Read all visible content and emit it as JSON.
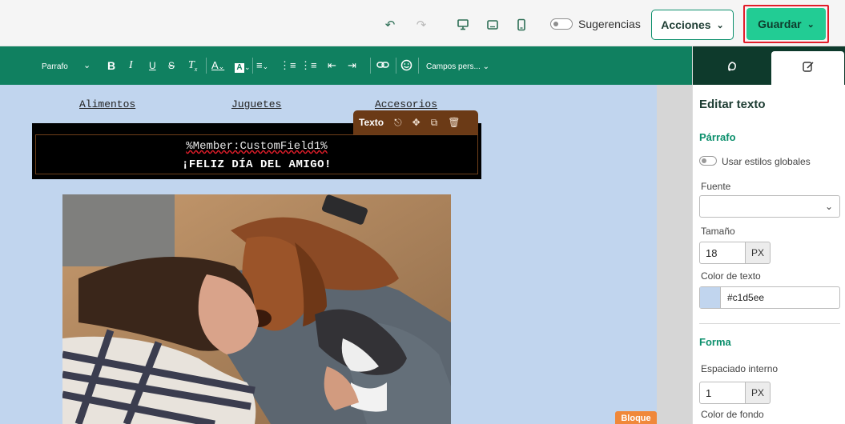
{
  "topbar": {
    "undo_icon": "undo-icon",
    "redo_icon": "redo-icon",
    "desktop_icon": "desktop-icon",
    "tablet_icon": "tablet-icon",
    "mobile_icon": "mobile-icon",
    "suggestions_label": "Sugerencias",
    "suggestions_on": false,
    "actions_label": "Acciones",
    "save_label": "Guardar",
    "accent_color": "#22cc94",
    "highlight_color": "#e21d2a"
  },
  "format_toolbar": {
    "paragraph_style": "Parrafo",
    "custom_fields_label": "Campos pers...",
    "tools": [
      "bold-icon",
      "italic-icon",
      "underline-icon",
      "strikethrough-icon",
      "clear-format-icon",
      "font-color-icon",
      "highlight-icon",
      "align-icon",
      "bullet-list-icon",
      "numbered-list-icon",
      "outdent-icon",
      "indent-icon",
      "link-icon",
      "emoji-icon"
    ],
    "background_color": "#108060"
  },
  "canvas": {
    "background_color": "#c1d5ee",
    "nav_links": [
      "Alimentos",
      "Juguetes",
      "Accesorios"
    ],
    "merge_field": "%Member:CustomField1%",
    "headline": "¡FELIZ DÍA DEL AMIGO!",
    "text_toolbar_label": "Texto",
    "text_toolbar_icons": [
      "save-block-icon",
      "move-icon",
      "duplicate-icon",
      "delete-icon"
    ],
    "block_tag_label": "Bloque",
    "photo_alt": ""
  },
  "panel": {
    "tabs": [
      "style-tab-icon",
      "edit-tab-icon"
    ],
    "active_tab": 1,
    "title": "Editar texto",
    "paragraph_section": "Párrafo",
    "global_styles_label": "Usar estilos globales",
    "font_label": "Fuente",
    "font_value": "",
    "size_label": "Tamaño",
    "size_value": "18",
    "size_unit": "PX",
    "text_color_label": "Color de texto",
    "text_color_value": "#c1d5ee",
    "shape_section": "Forma",
    "padding_label": "Espaciado interno",
    "padding_value": "1",
    "padding_unit": "PX",
    "bg_color_label": "Color de fondo"
  }
}
